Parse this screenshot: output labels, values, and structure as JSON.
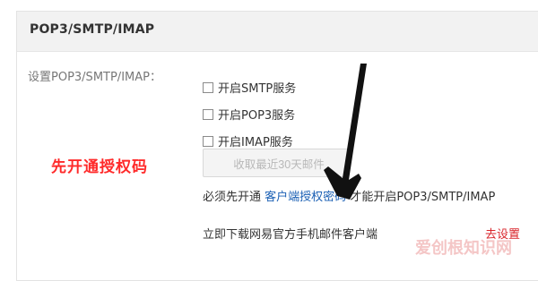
{
  "panel": {
    "title": "POP3/SMTP/IMAP"
  },
  "field_label": "设置POP3/SMTP/IMAP：",
  "checkboxes": [
    {
      "label": "开启SMTP服务",
      "checked": false
    },
    {
      "label": "开启POP3服务",
      "checked": false
    },
    {
      "label": "开启IMAP服务",
      "checked": false
    }
  ],
  "annotation": "先开通授权码",
  "receive_button": "收取最近30天邮件",
  "note": {
    "prefix": "必须先开通",
    "link": "客户端授权密码",
    "suffix": "才能开启POP3/SMTP/IMAP"
  },
  "download": {
    "text": "立即下载网易官方手机邮件客户端",
    "settings_link": "去设置"
  },
  "watermark": "爱创根知识网",
  "colors": {
    "annotation": "#ff2a2a",
    "link": "#1a5fb4",
    "header_bg": "#f2f2f2",
    "arrow": "#111111"
  },
  "icons": {
    "arrow": "pointing-arrow-icon"
  }
}
